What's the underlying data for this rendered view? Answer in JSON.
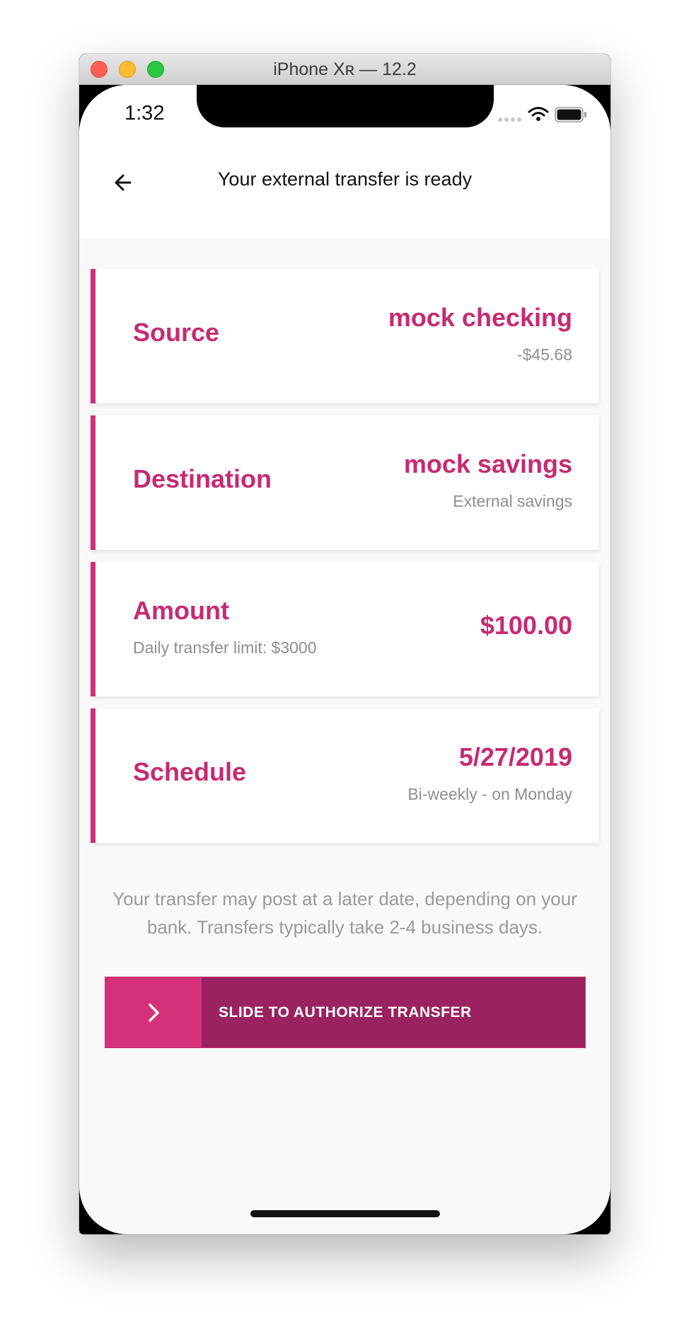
{
  "window": {
    "title": "iPhone Xʀ — 12.2"
  },
  "status_bar": {
    "time": "1:32"
  },
  "header": {
    "title": "Your external transfer is ready"
  },
  "cards": {
    "source": {
      "label": "Source",
      "value": "mock checking",
      "sub": "-$45.68"
    },
    "destination": {
      "label": "Destination",
      "value": "mock savings",
      "sub": "External savings"
    },
    "amount": {
      "label": "Amount",
      "value": "$100.00",
      "sub": "Daily transfer limit: $3000"
    },
    "schedule": {
      "label": "Schedule",
      "value": "5/27/2019",
      "sub": "Bi-weekly - on Monday"
    }
  },
  "disclaimer": "Your transfer may post at a later date, depending on your bank. Transfers typically take 2-4 business days.",
  "slider": {
    "label": "SLIDE TO AUTHORIZE TRANSFER"
  },
  "colors": {
    "accent": "#c62a72",
    "slider_track": "#9a2260",
    "slider_handle": "#d4317a"
  },
  "icons": {
    "back": "arrow-left-icon",
    "slider_handle": "chevron-right-icon",
    "wifi": "wifi-icon",
    "battery": "battery-icon"
  }
}
